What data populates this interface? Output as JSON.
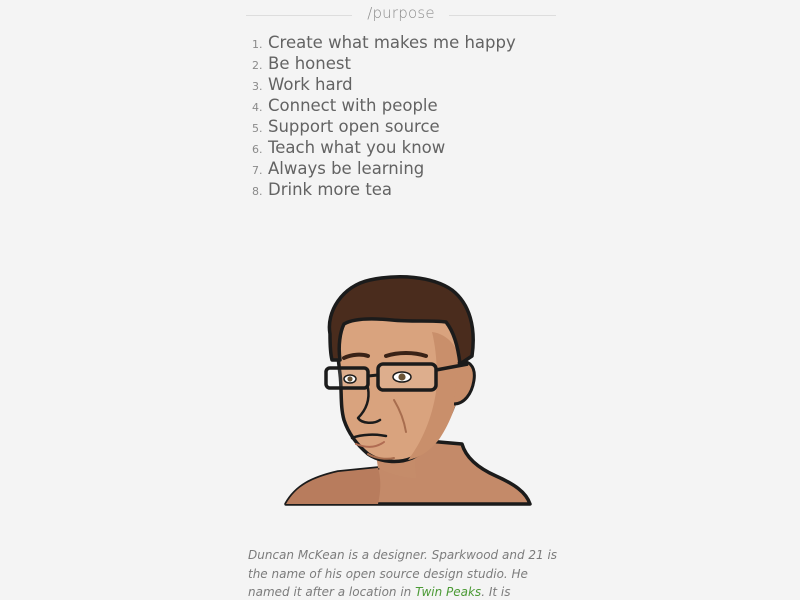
{
  "header": {
    "title": "/purpose"
  },
  "purpose": {
    "items": [
      {
        "num": "1.",
        "text": "Create what makes me happy"
      },
      {
        "num": "2.",
        "text": "Be honest"
      },
      {
        "num": "3.",
        "text": "Work hard"
      },
      {
        "num": "4.",
        "text": "Connect with people"
      },
      {
        "num": "5.",
        "text": "Support open source"
      },
      {
        "num": "6.",
        "text": "Teach what you know"
      },
      {
        "num": "7.",
        "text": "Always be learning"
      },
      {
        "num": "8.",
        "text": "Drink more tea"
      }
    ]
  },
  "bio": {
    "part1": "Duncan McKean is a designer. Sparkwood and 21 is the name of his open source design studio. He named it after a location in ",
    "link": "Twin Peaks",
    "part2": ". It is currently based just outside of Amsterdam."
  },
  "colors": {
    "background": "#f4f4f4",
    "link": "#4b9a35",
    "text": "#636363"
  }
}
